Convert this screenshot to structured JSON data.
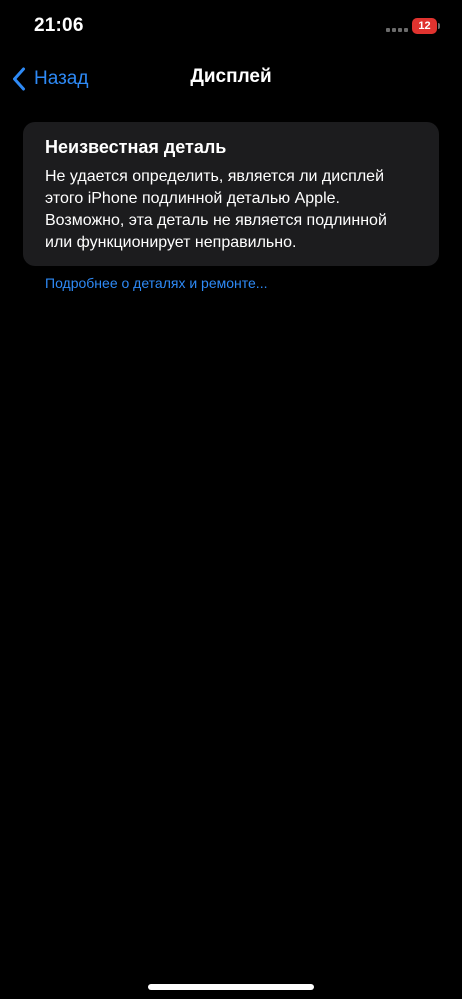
{
  "status_bar": {
    "time": "21:06",
    "battery_level": "12",
    "battery_icon": "battery-charging-icon",
    "signal_icon": "cellular-signal-icon"
  },
  "nav": {
    "back_label": "Назад",
    "back_icon": "chevron-left-icon",
    "title": "Дисплей"
  },
  "card": {
    "title": "Неизвестная деталь",
    "lines": [
      "Не удается определить, является ли дисплей",
      "этого iPhone подлинной деталью Apple.",
      "Возможно, эта деталь не является подлинной",
      "или функционирует неправильно."
    ]
  },
  "link": {
    "label": "Подробнее о деталях и ремонте..."
  },
  "colors": {
    "background": "#000000",
    "card": "#1c1c1e",
    "accent": "#2e8af6",
    "battery_low": "#e0332f"
  }
}
